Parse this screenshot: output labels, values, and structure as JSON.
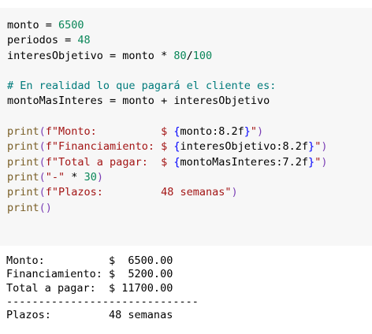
{
  "code_cell": {
    "lines": [
      [
        {
          "t": "monto = ",
          "c": "op"
        },
        {
          "t": "6500",
          "c": "num"
        }
      ],
      [
        {
          "t": "periodos = ",
          "c": "op"
        },
        {
          "t": "48",
          "c": "num"
        }
      ],
      [
        {
          "t": "interesObjetivo = monto * ",
          "c": "op"
        },
        {
          "t": "80",
          "c": "num"
        },
        {
          "t": "/",
          "c": "op"
        },
        {
          "t": "100",
          "c": "num"
        }
      ],
      [],
      [
        {
          "t": "# En realidad lo que pagará el cliente es:",
          "c": "comment"
        }
      ],
      [
        {
          "t": "montoMasInteres = monto + interesObjetivo",
          "c": "op"
        }
      ],
      [],
      [
        {
          "t": "print",
          "c": "builtin"
        },
        {
          "t": "(",
          "c": "paren"
        },
        {
          "t": "f\"Monto:          $ ",
          "c": "str"
        },
        {
          "t": "{",
          "c": "brace"
        },
        {
          "t": "monto:8.2f",
          "c": "op"
        },
        {
          "t": "}",
          "c": "brace"
        },
        {
          "t": "\"",
          "c": "str"
        },
        {
          "t": ")",
          "c": "paren"
        }
      ],
      [
        {
          "t": "print",
          "c": "builtin"
        },
        {
          "t": "(",
          "c": "paren"
        },
        {
          "t": "f\"Financiamiento: $ ",
          "c": "str"
        },
        {
          "t": "{",
          "c": "brace"
        },
        {
          "t": "interesObjetivo:8.2f",
          "c": "op"
        },
        {
          "t": "}",
          "c": "brace"
        },
        {
          "t": "\"",
          "c": "str"
        },
        {
          "t": ")",
          "c": "paren"
        }
      ],
      [
        {
          "t": "print",
          "c": "builtin"
        },
        {
          "t": "(",
          "c": "paren"
        },
        {
          "t": "f\"Total a pagar:  $ ",
          "c": "str"
        },
        {
          "t": "{",
          "c": "brace"
        },
        {
          "t": "montoMasInteres:7.2f",
          "c": "op"
        },
        {
          "t": "}",
          "c": "brace"
        },
        {
          "t": "\"",
          "c": "str"
        },
        {
          "t": ")",
          "c": "paren"
        }
      ],
      [
        {
          "t": "print",
          "c": "builtin"
        },
        {
          "t": "(",
          "c": "paren"
        },
        {
          "t": "\"-\"",
          "c": "str"
        },
        {
          "t": " * ",
          "c": "op"
        },
        {
          "t": "30",
          "c": "num"
        },
        {
          "t": ")",
          "c": "paren"
        }
      ],
      [
        {
          "t": "print",
          "c": "builtin"
        },
        {
          "t": "(",
          "c": "paren"
        },
        {
          "t": "f\"Plazos:         48 semanas\"",
          "c": "str"
        },
        {
          "t": ")",
          "c": "paren"
        }
      ],
      [
        {
          "t": "print",
          "c": "builtin"
        },
        {
          "t": "()",
          "c": "paren"
        }
      ]
    ]
  },
  "output_cell": {
    "lines": [
      "Monto:          $  6500.00",
      "Financiamiento: $  5200.00",
      "Total a pagar:  $ 11700.00",
      "------------------------------",
      "Plazos:         48 semanas"
    ]
  },
  "colors": {
    "num": "#098658",
    "comment": "#007b7b",
    "builtin": "#795e26",
    "str": "#a31515",
    "paren": "#7b3fb5",
    "brace": "#0000ff"
  }
}
